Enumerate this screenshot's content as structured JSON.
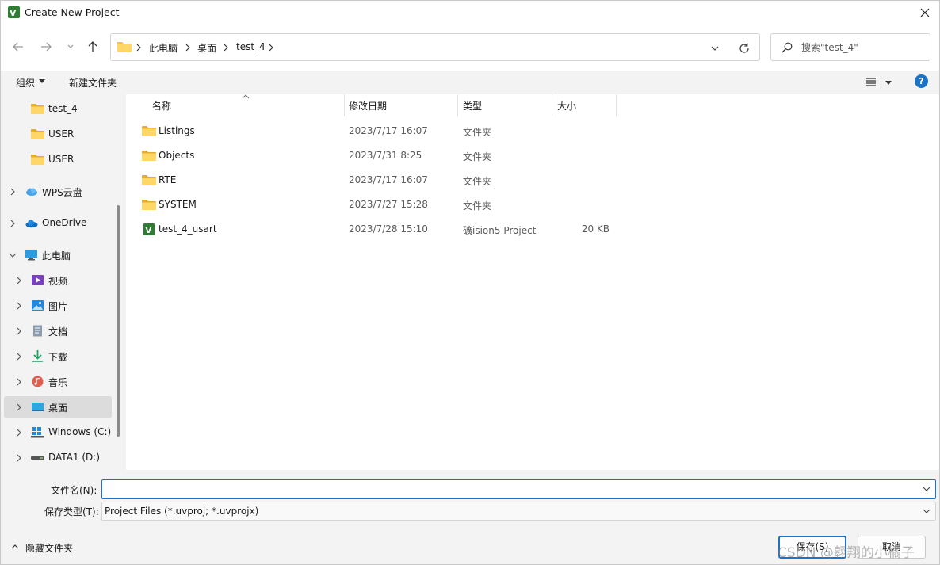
{
  "window": {
    "title": "Create New Project"
  },
  "address": {
    "crumbs": [
      "此电脑",
      "桌面",
      "test_4"
    ]
  },
  "search": {
    "placeholder": "搜索\"test_4\""
  },
  "commandbar": {
    "organize": "组织",
    "new_folder": "新建文件夹",
    "help": "?"
  },
  "navpane": {
    "items": [
      {
        "label": "test_4",
        "icon": "folder-icon"
      },
      {
        "label": "USER",
        "icon": "folder-icon"
      },
      {
        "label": "USER",
        "icon": "folder-icon"
      },
      {
        "label": "WPS云盘",
        "icon": "cloud-icon"
      },
      {
        "label": "OneDrive",
        "icon": "onedrive-icon"
      },
      {
        "label": "此电脑",
        "icon": "pc-icon"
      },
      {
        "label": "视频",
        "icon": "video-icon"
      },
      {
        "label": "图片",
        "icon": "picture-icon"
      },
      {
        "label": "文档",
        "icon": "document-icon"
      },
      {
        "label": "下载",
        "icon": "download-icon"
      },
      {
        "label": "音乐",
        "icon": "music-icon"
      },
      {
        "label": "桌面",
        "icon": "desktop-icon"
      },
      {
        "label": "Windows (C:)",
        "icon": "drive-icon"
      },
      {
        "label": "DATA1 (D:)",
        "icon": "drive-icon"
      }
    ]
  },
  "columns": {
    "name": "名称",
    "date": "修改日期",
    "type": "类型",
    "size": "大小"
  },
  "files": [
    {
      "name": "Listings",
      "date": "2023/7/17 16:07",
      "type": "文件夹",
      "size": "",
      "icon": "folder-icon"
    },
    {
      "name": "Objects",
      "date": "2023/7/31 8:25",
      "type": "文件夹",
      "size": "",
      "icon": "folder-icon"
    },
    {
      "name": "RTE",
      "date": "2023/7/17 16:07",
      "type": "文件夹",
      "size": "",
      "icon": "folder-icon"
    },
    {
      "name": "SYSTEM",
      "date": "2023/7/27 15:28",
      "type": "文件夹",
      "size": "",
      "icon": "folder-icon"
    },
    {
      "name": "test_4_usart",
      "date": "2023/7/28 15:10",
      "type": "礦ision5 Project",
      "size": "20 KB",
      "icon": "uvision-project-icon"
    }
  ],
  "form": {
    "filename_label": "文件名(N):",
    "filename_value": "",
    "filetype_label": "保存类型(T):",
    "filetype_value": "Project Files (*.uvproj; *.uvprojx)",
    "hide_folders": "隐藏文件夹",
    "save": "保存(S)",
    "cancel": "取消"
  },
  "watermark": "CSDN @翱翔的小橘子",
  "colors": {
    "accent": "#1a73c8",
    "folder": "#f5c242",
    "selected": "#dcdcdc",
    "pane_bg": "#f3f3f3"
  }
}
